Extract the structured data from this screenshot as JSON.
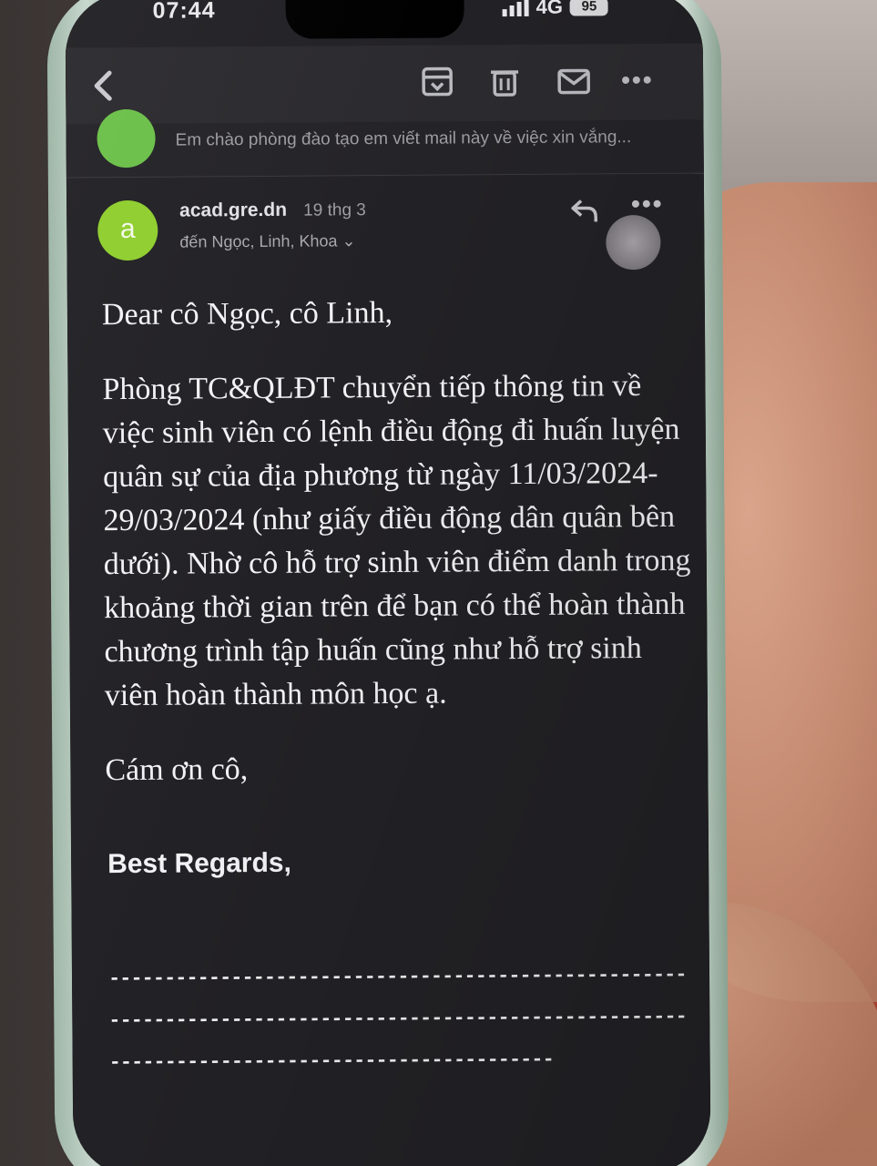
{
  "status_bar": {
    "time": "07:44",
    "network": "4G",
    "battery": "95"
  },
  "toolbar": {
    "icons": [
      "back-chevron-icon",
      "archive-icon",
      "trash-icon",
      "mail-icon",
      "more-icon"
    ]
  },
  "thread_preview": {
    "snippet": "Em chào phòng đào tạo em viết mail này về việc xin vắng..."
  },
  "message": {
    "avatar_letter": "a",
    "sender": "acad.gre.dn",
    "date": "19 thg 3",
    "recipients": "đến Ngọc, Linh, Khoa ⌄",
    "greeting": "Dear cô Ngọc, cô Linh,",
    "paragraph": "Phòng TC&QLĐT chuyển tiếp thông tin về việc sinh viên có lệnh điều động đi huấn luyện quân sự của địa phương từ ngày 11/03/2024-29/03/2024 (như giấy điều động dân quân bên dưới). Nhờ cô hỗ trợ sinh viên điểm danh trong khoảng thời gian trên để bạn có thể hoàn thành chương trình tập huấn cũng như hỗ trợ sinh viên hoàn thành môn học ạ.",
    "thanks": "Cám ơn cô,",
    "signoff": "Best Regards,",
    "separator": "------------------------------------------------------------------------------------------------------------------------------------------------"
  },
  "colors": {
    "screen_bg": "#222125",
    "avatar_green": "#8fce2e",
    "text": "#f2f2f4"
  }
}
